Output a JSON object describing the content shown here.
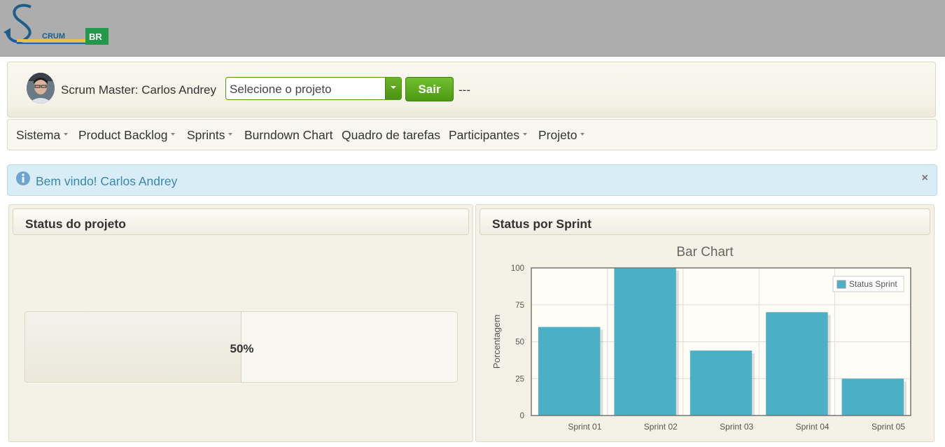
{
  "logo": {
    "text": "CRUM",
    "badge": "BR"
  },
  "user": {
    "label": "Scrum Master: Carlos Andrey"
  },
  "project_select": {
    "value": "Selecione o projeto"
  },
  "sair_label": "Sair",
  "project_status": "---",
  "nav": {
    "items": [
      {
        "label": "Sistema",
        "dropdown": true
      },
      {
        "label": "Product Backlog",
        "dropdown": true
      },
      {
        "label": "Sprints",
        "dropdown": true
      },
      {
        "label": "Burndown Chart",
        "dropdown": false
      },
      {
        "label": "Quadro de tarefas",
        "dropdown": false
      },
      {
        "label": "Participantes",
        "dropdown": true
      },
      {
        "label": "Projeto",
        "dropdown": true
      }
    ]
  },
  "alert": {
    "message": "Bem vindo! Carlos Andrey",
    "close": "×"
  },
  "panels": {
    "left": {
      "title": "Status do projeto"
    },
    "right": {
      "title": "Status por Sprint"
    }
  },
  "progress": {
    "value": 50,
    "label": "50%"
  },
  "chart_data": {
    "type": "bar",
    "title": "Bar Chart",
    "ylabel": "Porcentagem",
    "xlabel": "",
    "categories": [
      "Sprint 01",
      "Sprint 02",
      "Sprint 03",
      "Sprint 04",
      "Sprint 05"
    ],
    "series": [
      {
        "name": "Status Sprint",
        "values": [
          60,
          100,
          44,
          70,
          25
        ]
      }
    ],
    "ylim": [
      0,
      100
    ],
    "yticks": [
      0,
      25,
      50,
      75,
      100
    ],
    "grid": true,
    "legend": "top-right",
    "colors": {
      "bar": "#4bafc6",
      "plot_bg": "#fffdf6",
      "title": "#666666"
    }
  }
}
